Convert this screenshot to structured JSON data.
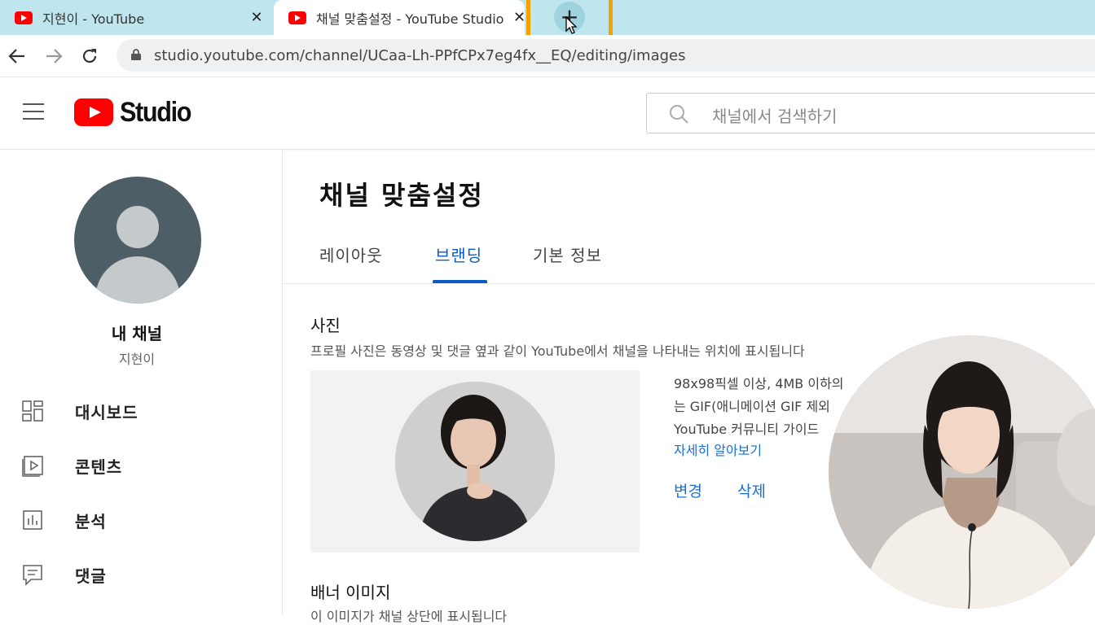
{
  "browser": {
    "tabs": [
      {
        "title": "지현이 - YouTube",
        "close": "✕"
      },
      {
        "title": "채널 맞춤설정 - YouTube Studio",
        "close": "✕"
      }
    ],
    "new_tab": "+",
    "url": "studio.youtube.com/channel/UCaa-Lh-PPfCPx7eg4fx__EQ/editing/images",
    "highlight_color": "#f5a200"
  },
  "header": {
    "logo_text": "Studio",
    "search_placeholder": "채널에서 검색하기"
  },
  "sidebar": {
    "my_channel_label": "내 채널",
    "channel_name": "지현이",
    "items": [
      {
        "label": "대시보드",
        "icon": "dashboard-icon"
      },
      {
        "label": "콘텐츠",
        "icon": "content-icon"
      },
      {
        "label": "분석",
        "icon": "analytics-icon"
      },
      {
        "label": "댓글",
        "icon": "comments-icon"
      }
    ]
  },
  "main": {
    "title": "채널 맞춤설정",
    "tabs": [
      {
        "label": "레이아웃",
        "active": false
      },
      {
        "label": "브랜딩",
        "active": true
      },
      {
        "label": "기본 정보",
        "active": false
      }
    ],
    "photo": {
      "heading": "사진",
      "description": "프로필 사진은 동영상 및 댓글 옆과 같이 YouTube에서 채널을 나타내는 위치에 표시됩니다",
      "info_lines": [
        "98x98픽셀 이상, 4MB 이하의",
        "는 GIF(애니메이션 GIF 제외",
        "YouTube 커뮤니티 가이드"
      ],
      "learn_more": "자세히 알아보기",
      "change": "변경",
      "delete": "삭제"
    },
    "banner": {
      "heading": "배너 이미지",
      "description": "이 이미지가 채널 상단에 표시됩니다"
    }
  },
  "colors": {
    "accent": "#0b5bc2",
    "link": "#1a6fd6",
    "youtube_red": "#ff0000",
    "tabbar_bg": "#bfe6ee"
  }
}
